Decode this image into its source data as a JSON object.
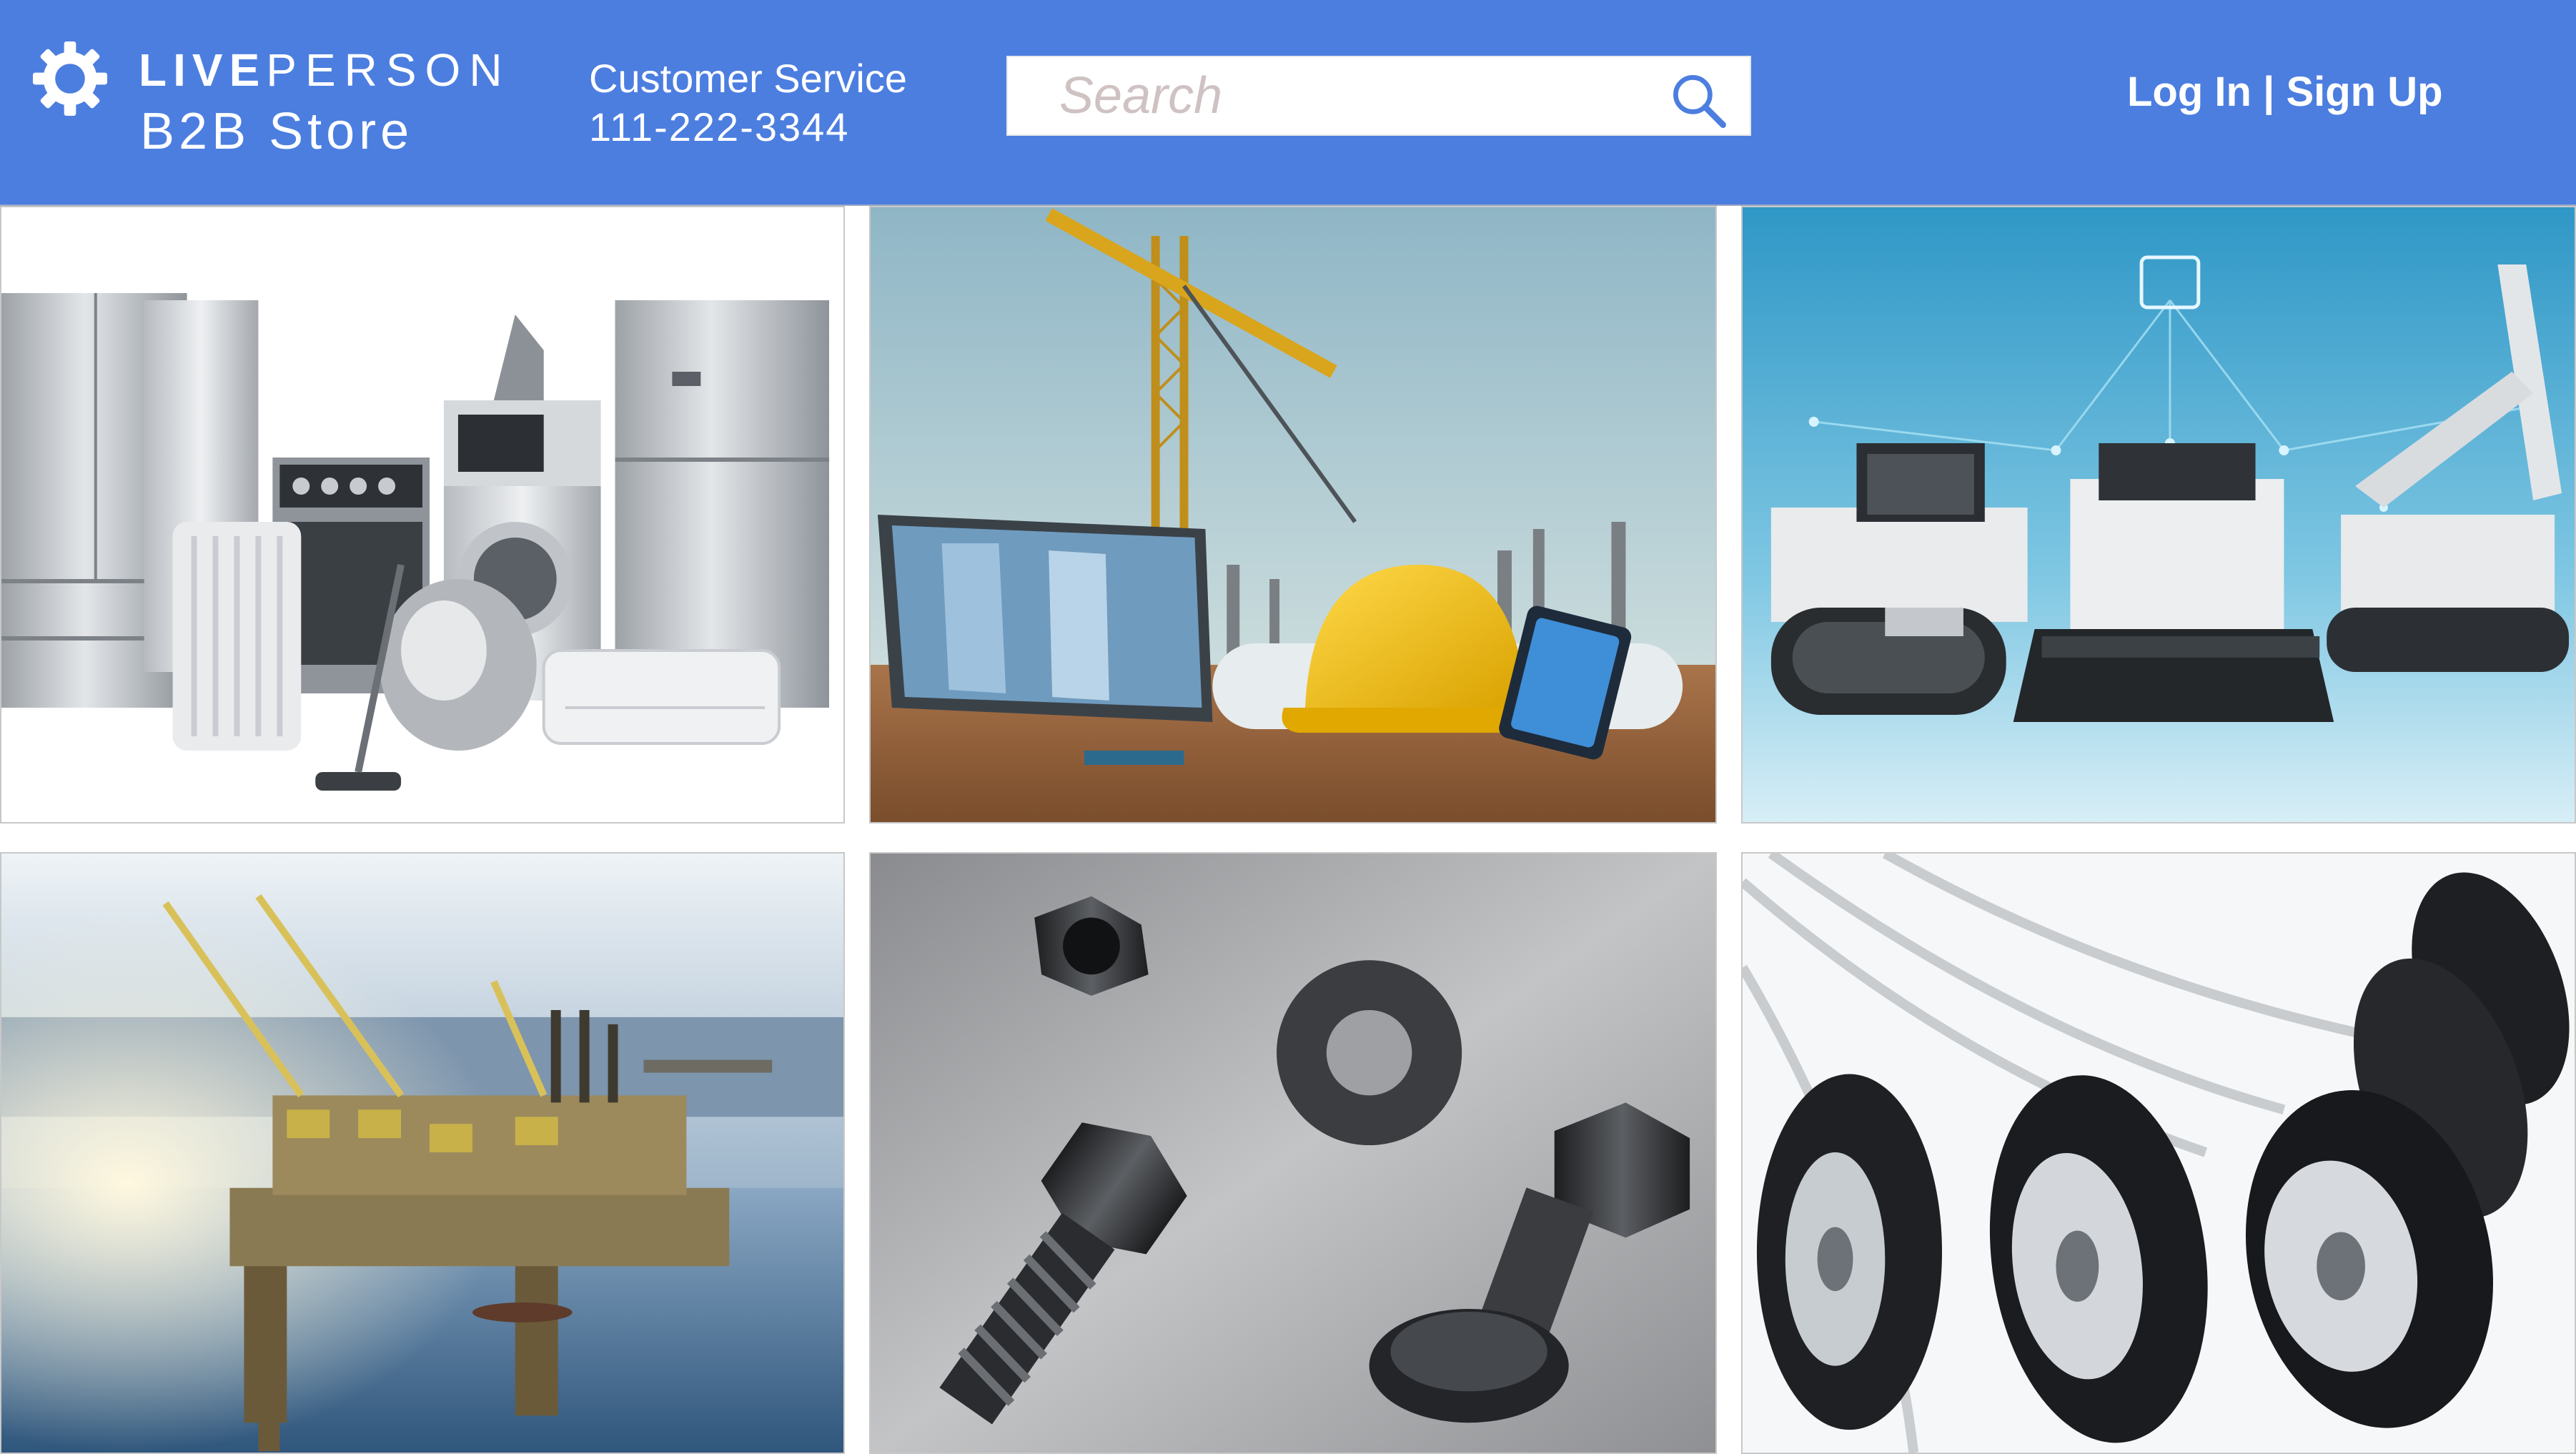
{
  "header": {
    "brand": {
      "word1": "LIVE",
      "word2": "PERSON",
      "subtitle": "B2B Store"
    },
    "customer_service": {
      "label": "Customer Service",
      "phone": "111-222-3344"
    },
    "search": {
      "placeholder": "Search",
      "value": ""
    },
    "auth": {
      "login": "Log In",
      "separator": "|",
      "signup": "Sign Up"
    }
  },
  "colors": {
    "header_bg": "#4c7ee0",
    "header_text": "#ffffff"
  },
  "icons": {
    "logo": "gear-icon",
    "search": "search-icon"
  },
  "categories": [
    {
      "id": "appliances"
    },
    {
      "id": "construction"
    },
    {
      "id": "heavy-machinery"
    },
    {
      "id": "oil-gas"
    },
    {
      "id": "fasteners"
    },
    {
      "id": "tires"
    }
  ]
}
